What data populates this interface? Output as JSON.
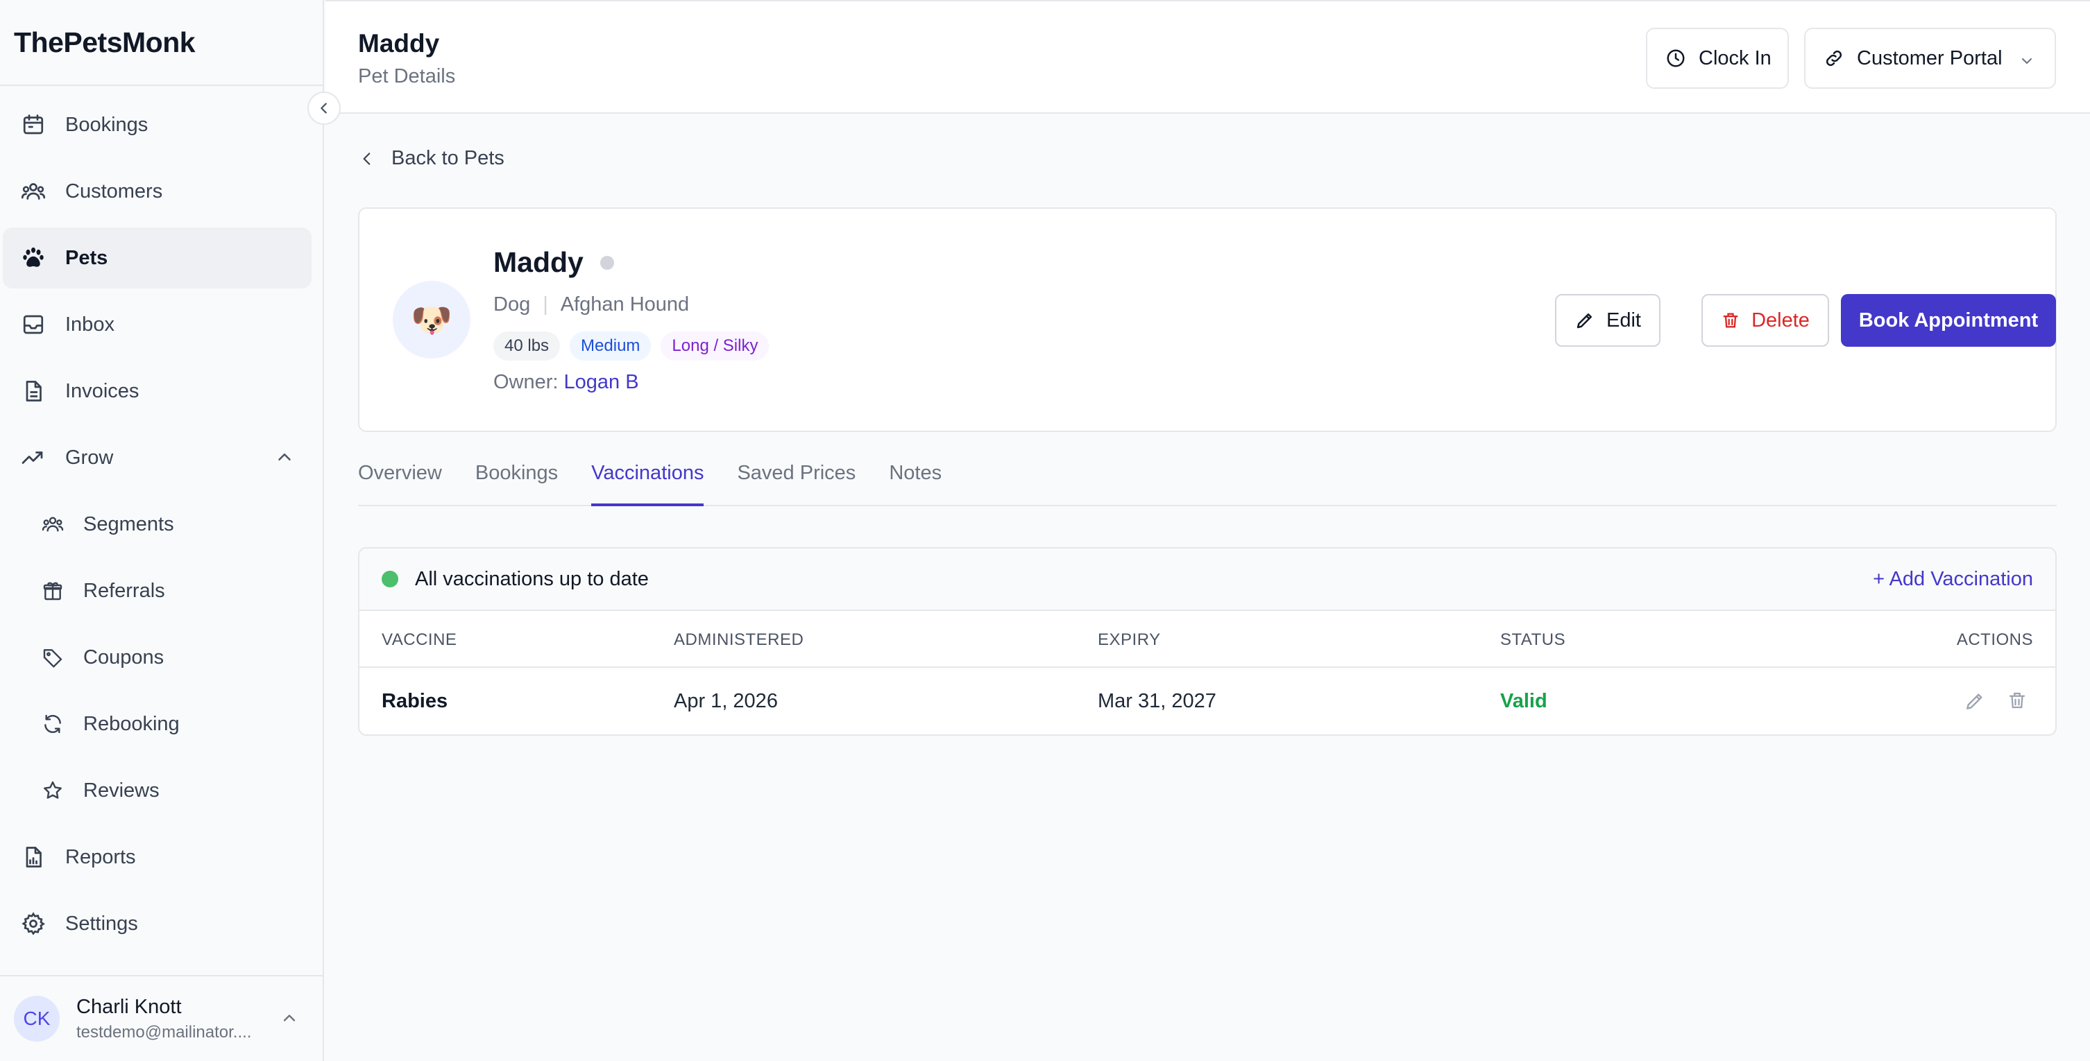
{
  "app": {
    "brand": "ThePetsMonk"
  },
  "sidebar": {
    "items": [
      {
        "label": "Bookings",
        "icon": "calendar-icon"
      },
      {
        "label": "Customers",
        "icon": "users-icon"
      },
      {
        "label": "Pets",
        "icon": "paw-icon",
        "active": true
      },
      {
        "label": "Inbox",
        "icon": "inbox-icon"
      },
      {
        "label": "Invoices",
        "icon": "file-icon"
      },
      {
        "label": "Grow",
        "icon": "trending-up-icon",
        "expanded": true
      },
      {
        "label": "Segments",
        "icon": "users-icon"
      },
      {
        "label": "Referrals",
        "icon": "gift-icon"
      },
      {
        "label": "Coupons",
        "icon": "tag-icon"
      },
      {
        "label": "Rebooking",
        "icon": "refresh-icon"
      },
      {
        "label": "Reviews",
        "icon": "star-icon"
      },
      {
        "label": "Reports",
        "icon": "report-icon"
      },
      {
        "label": "Settings",
        "icon": "gear-icon"
      }
    ],
    "user": {
      "initials": "CK",
      "name": "Charli Knott",
      "email": "testdemo@mailinator...."
    }
  },
  "header": {
    "title": "Maddy",
    "subtitle": "Pet Details",
    "clock_in_label": "Clock In",
    "portal_label": "Customer Portal"
  },
  "main": {
    "back_label": "Back to Pets",
    "pet": {
      "name": "Maddy",
      "avatar_emoji": "🐶",
      "species": "Dog",
      "breed": "Afghan Hound",
      "weight": "40 lbs",
      "size": "Medium",
      "coat": "Long / Silky",
      "owner_label": "Owner:",
      "owner_name": "Logan B"
    },
    "actions": {
      "edit": "Edit",
      "delete": "Delete",
      "book": "Book Appointment"
    },
    "tabs": [
      {
        "label": "Overview"
      },
      {
        "label": "Bookings"
      },
      {
        "label": "Vaccinations",
        "active": true
      },
      {
        "label": "Saved Prices"
      },
      {
        "label": "Notes"
      }
    ],
    "vaccinations": {
      "status_text": "All vaccinations up to date",
      "add_label": "+ Add Vaccination",
      "columns": [
        "VACCINE",
        "ADMINISTERED",
        "EXPIRY",
        "STATUS",
        "ACTIONS"
      ],
      "rows": [
        {
          "vaccine": "Rabies",
          "administered": "Apr 1, 2026",
          "expiry": "Mar 31, 2027",
          "status": "Valid"
        }
      ]
    }
  },
  "colors": {
    "accent": "#4338ca",
    "danger": "#dc2626",
    "valid": "#16a34a",
    "status_ok": "#4bbf6b"
  }
}
